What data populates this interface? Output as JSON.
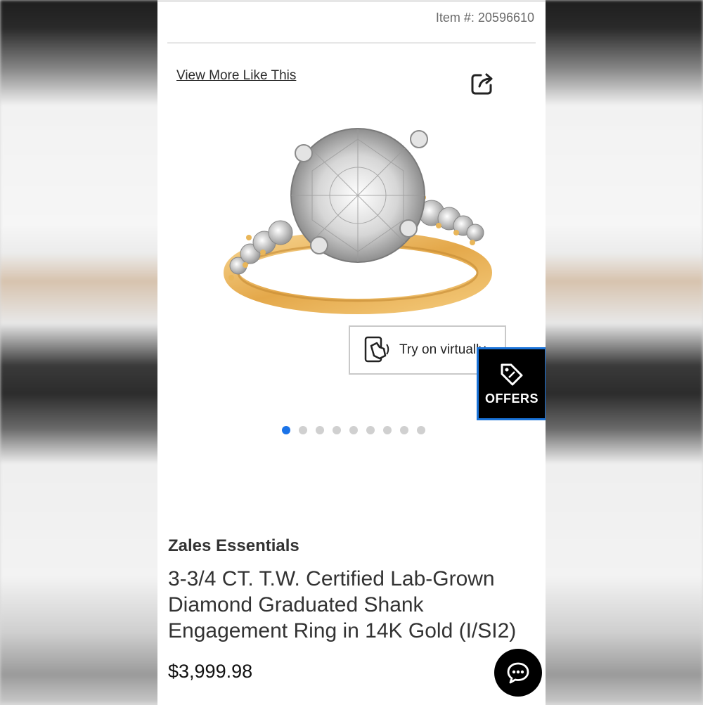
{
  "header": {
    "item_number": "Item #: 20596610"
  },
  "gallery": {
    "view_more_label": "View More Like This",
    "share_icon": "share-icon",
    "try_on_label": "Try on virtually",
    "try_on_icon": "hand-phone-icon",
    "offers_label": "OFFERS",
    "offers_icon": "tag-icon",
    "dots_count": 9,
    "active_dot": 0
  },
  "product": {
    "brand": "Zales Essentials",
    "title": "3-3/4 CT. T.W. Certified Lab-Grown Diamond Graduated Shank Engagement Ring in 14K Gold (I/SI2)",
    "price": "$3,999.98"
  },
  "chat": {
    "icon": "chat-bubble-icon"
  },
  "colors": {
    "accent_blue": "#1a73e8",
    "offers_bg": "#000000",
    "gold": "#e9b659"
  }
}
